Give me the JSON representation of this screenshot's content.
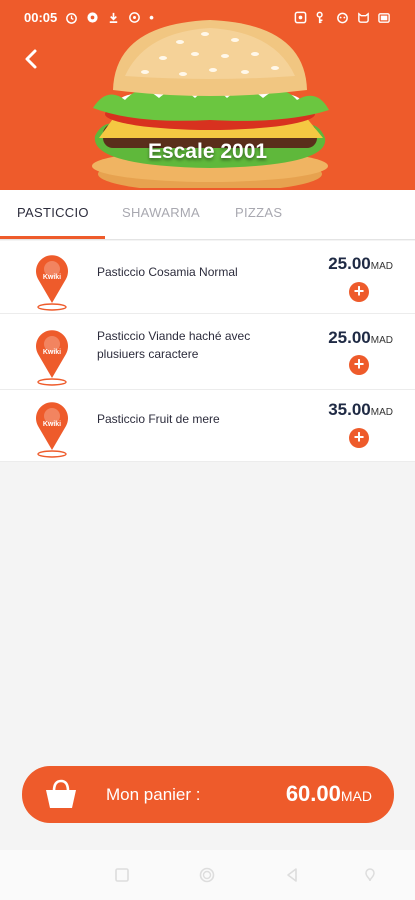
{
  "status": {
    "time": "00:05",
    "dot": "•"
  },
  "header": {
    "restaurant_name": "Escale 2001",
    "back_icon": "back-arrow-icon"
  },
  "tabs": [
    {
      "label": "PASTICCIO",
      "active": true
    },
    {
      "label": "SHAWARMA",
      "active": false
    },
    {
      "label": "PIZZAS",
      "active": false
    }
  ],
  "items": [
    {
      "name": "Pasticcio Cosamia Normal",
      "price": "25.00",
      "currency": "MAD"
    },
    {
      "name": "Pasticcio Viande haché avec plusiuers caractere",
      "price": "25.00",
      "currency": "MAD"
    },
    {
      "name": "Pasticcio Fruit de mere",
      "price": "35.00",
      "currency": "MAD"
    }
  ],
  "add_symbol": "+",
  "logo_text": "Kwiki",
  "cart": {
    "label": "Mon panier :",
    "total": "60.00",
    "currency": "MAD"
  },
  "colors": {
    "accent": "#ee5b2b",
    "price_text": "#1f2a44"
  }
}
